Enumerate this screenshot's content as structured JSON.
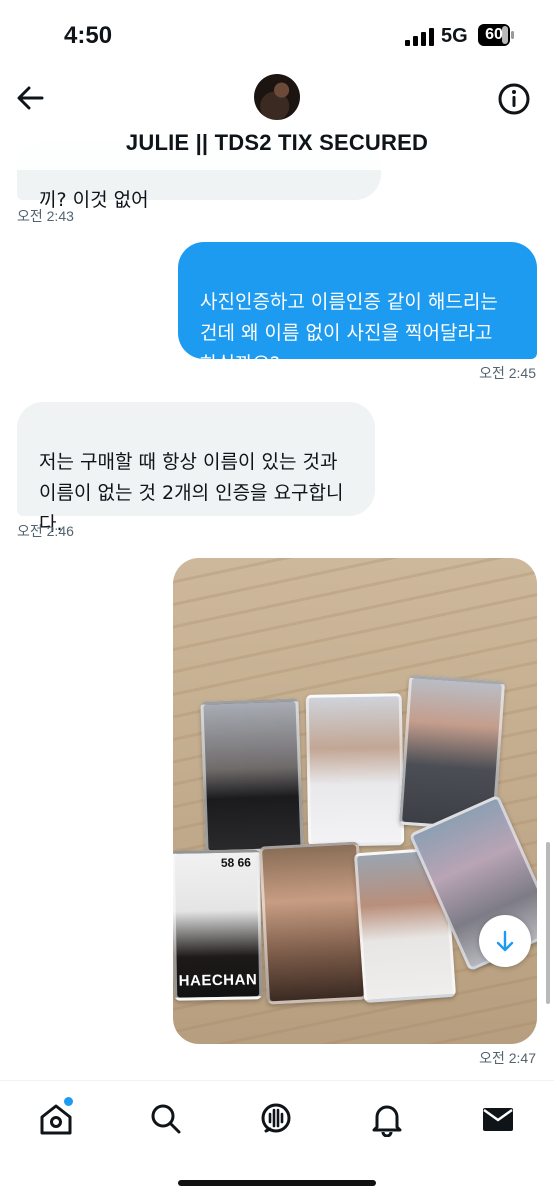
{
  "status_bar": {
    "time": "4:50",
    "network": "5G",
    "battery": "60"
  },
  "header": {
    "title": "JULIE || TDS2 TIX SECURED"
  },
  "messages": [
    {
      "type": "received",
      "text": "끼? 이것 없어",
      "time": "오전 2:43"
    },
    {
      "type": "sent",
      "text": "사진인증하고 이름인증 같이 해드리는\n건데 왜 이름 없이 사진을 찍어달라고\n하실까요?",
      "time": "오전 2:45"
    },
    {
      "type": "received",
      "text": "저는 구매할 때 항상 이름이 있는 것과\n이름이 없는 것 2개의 인증을 요구합니\n다.",
      "time": "오전 2:46"
    },
    {
      "type": "sent_image",
      "time": "오전 2:47",
      "card_label": "HAECHAN",
      "card_number": "58 66"
    }
  ],
  "nav": [
    "home",
    "search",
    "spaces",
    "notifications",
    "messages"
  ],
  "colors": {
    "accent": "#1d9bf0",
    "received_bubble": "#eff3f4",
    "timestamp": "#536471"
  }
}
